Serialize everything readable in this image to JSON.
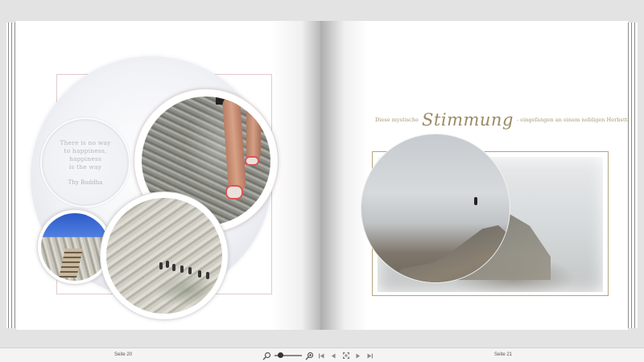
{
  "left_page": {
    "quote_lines": [
      "There is no way",
      "to happiness,",
      "happiness",
      "is the way"
    ],
    "quote_author": "Thy Buddha"
  },
  "right_page": {
    "heading_pre": "Diese mystische",
    "heading_word": "Stimmung",
    "heading_post": "- eingefangen an einem nebligen Herbsttag"
  },
  "statusbar": {
    "left_page_label": "Seite 20",
    "right_page_label": "Seite 21",
    "zoom_fraction": 0.15
  },
  "icons": {
    "zoom_out": "zoom-out-icon",
    "zoom_in": "zoom-in-icon",
    "first": "first-page-icon",
    "prev": "previous-page-icon",
    "fit": "fit-to-window-icon",
    "next": "next-page-icon",
    "last": "last-page-icon"
  }
}
